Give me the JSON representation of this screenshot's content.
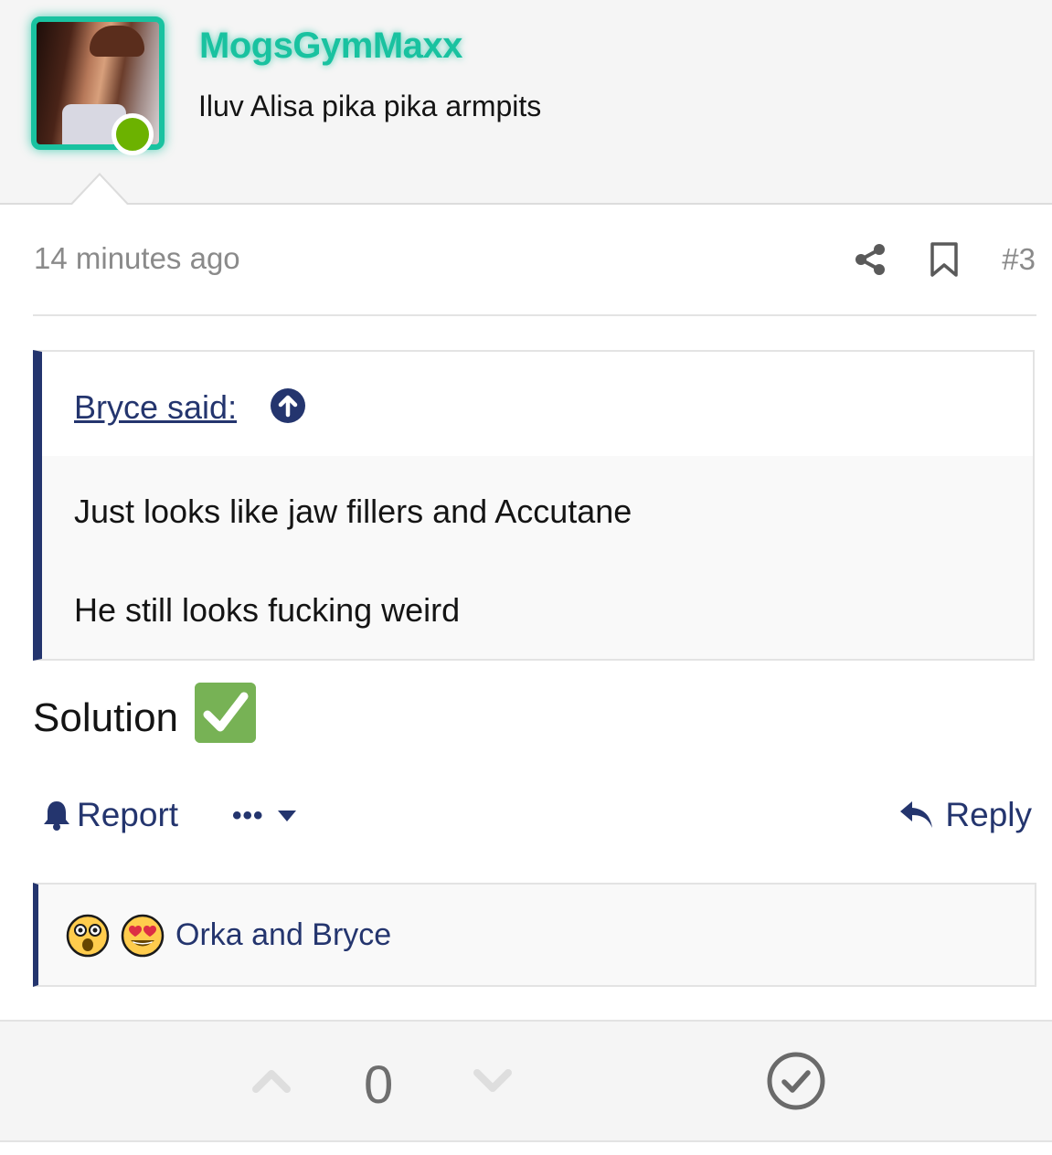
{
  "header": {
    "username": "MogsGymMaxx",
    "user_title": "Iluv Alisa pika pika armpits",
    "avatar_icon": "user-avatar-photo",
    "online_indicator_color": "#6cb200",
    "username_color": "#19c2a0"
  },
  "post": {
    "time": "14 minutes ago",
    "share_icon": "share-icon",
    "bookmark_icon": "bookmark-icon",
    "number": "#3",
    "quote": {
      "author_label": "Bryce said:",
      "jump_icon": "arrow-up-circle-icon",
      "lines": [
        "Just looks like jaw fillers and Accutane",
        "He still looks fucking weird"
      ]
    },
    "body": "Solution",
    "body_emoji": "white-check-mark-emoji"
  },
  "actions": {
    "report_label": "Report",
    "more_label": "•••",
    "reply_label": "Reply"
  },
  "reactions": {
    "emojis": [
      "astonished-face",
      "heart-eyes-face"
    ],
    "users_text": "Orka and Bryce"
  },
  "votes": {
    "count": "0",
    "solution_icon": "check-circle-icon"
  },
  "colors": {
    "link": "#24356e",
    "accent_green": "#77b255",
    "muted": "#8a8a8a"
  }
}
